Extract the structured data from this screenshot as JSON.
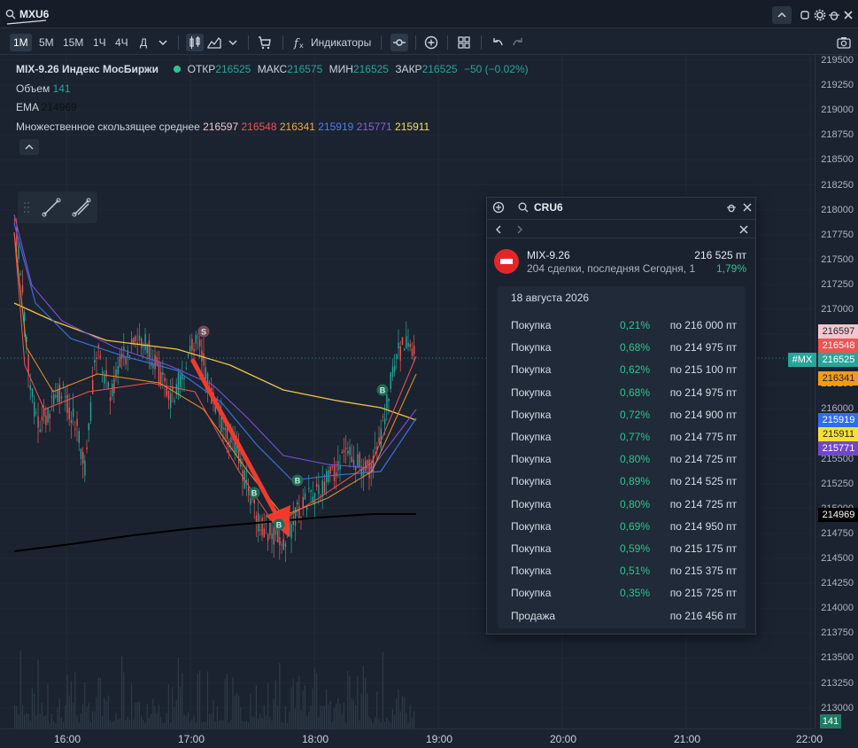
{
  "titlebar": {
    "ticker": "MXU6"
  },
  "toolbar": {
    "timeframes": [
      "1M",
      "5M",
      "15M",
      "1Ч",
      "4Ч",
      "Д"
    ],
    "indicators_label": "Индикаторы"
  },
  "legend": {
    "instrument": "MIX-9.26 Индекс МосБиржи",
    "open_label": "ОТКР",
    "open": "216525",
    "high_label": "МАКС",
    "high": "216575",
    "low_label": "МИН",
    "low": "216525",
    "close_label": "ЗАКР",
    "close": "216525",
    "change": "−50 (−0.02%)",
    "volume_label": "Объем",
    "volume": "141",
    "ema_label": "EMA",
    "ema": "214969",
    "mma_label": "Множественное скользящее среднее",
    "mma_values": [
      "216597",
      "216548",
      "216341",
      "215919",
      "215771",
      "215911"
    ]
  },
  "price_axis": {
    "ticks": [
      "219500",
      "219250",
      "219000",
      "218750",
      "218500",
      "218250",
      "218000",
      "217750",
      "217500",
      "217250",
      "217000",
      "216750",
      "216500",
      "216250",
      "216000",
      "215750",
      "215500",
      "215250",
      "215000",
      "214750",
      "214500",
      "214250",
      "214000",
      "213750",
      "213500",
      "213250",
      "213000"
    ],
    "labels": {
      "p1": "216597",
      "p2": "216548",
      "mx_tag": "#MX",
      "current": "216525",
      "p3": "216341",
      "p4": "215919",
      "p5": "215911",
      "p6": "215771",
      "ema": "214969",
      "volume": "141"
    }
  },
  "time_axis": {
    "ticks": [
      "16:00",
      "17:00",
      "18:00",
      "19:00",
      "20:00",
      "21:00",
      "22:00"
    ]
  },
  "panel": {
    "search_value": "CRU6",
    "instrument_name": "MIX-9.26",
    "instrument_price": "216 525 пт",
    "instrument_info": "204 сделки, последняя Сегодня, 1...",
    "instrument_change": "1,79%",
    "date": "18 августа 2026",
    "trades": [
      {
        "side": "Покупка",
        "pct": "0,21%",
        "price": "по 216 000 пт"
      },
      {
        "side": "Покупка",
        "pct": "0,68%",
        "price": "по 214 975 пт"
      },
      {
        "side": "Покупка",
        "pct": "0,62%",
        "price": "по 215 100 пт"
      },
      {
        "side": "Покупка",
        "pct": "0,68%",
        "price": "по 214 975 пт"
      },
      {
        "side": "Покупка",
        "pct": "0,72%",
        "price": "по 214 900 пт"
      },
      {
        "side": "Покупка",
        "pct": "0,77%",
        "price": "по 214 775 пт"
      },
      {
        "side": "Покупка",
        "pct": "0,80%",
        "price": "по 214 725 пт"
      },
      {
        "side": "Покупка",
        "pct": "0,89%",
        "price": "по 214 525 пт"
      },
      {
        "side": "Покупка",
        "pct": "0,80%",
        "price": "по 214 725 пт"
      },
      {
        "side": "Покупка",
        "pct": "0,69%",
        "price": "по 214 950 пт"
      },
      {
        "side": "Покупка",
        "pct": "0,59%",
        "price": "по 215 175 пт"
      },
      {
        "side": "Покупка",
        "pct": "0,51%",
        "price": "по 215 375 пт"
      },
      {
        "side": "Покупка",
        "pct": "0,35%",
        "price": "по 215 725 пт"
      },
      {
        "side": "Продажа",
        "pct": "",
        "price": "по 216 456 пт"
      }
    ]
  },
  "markers": {
    "sell": "S",
    "buy": "B"
  },
  "colors": {
    "background": "#1b2330",
    "up": "#26a69a",
    "down": "#ef5350",
    "arrow": "#f03a2e",
    "ema": "#000000",
    "ma1": "#f6c343",
    "ma2": "#3b6fd8",
    "ma3": "#7b4fd8",
    "ma4": "#e08a2e",
    "ma5": "#ef5350"
  }
}
